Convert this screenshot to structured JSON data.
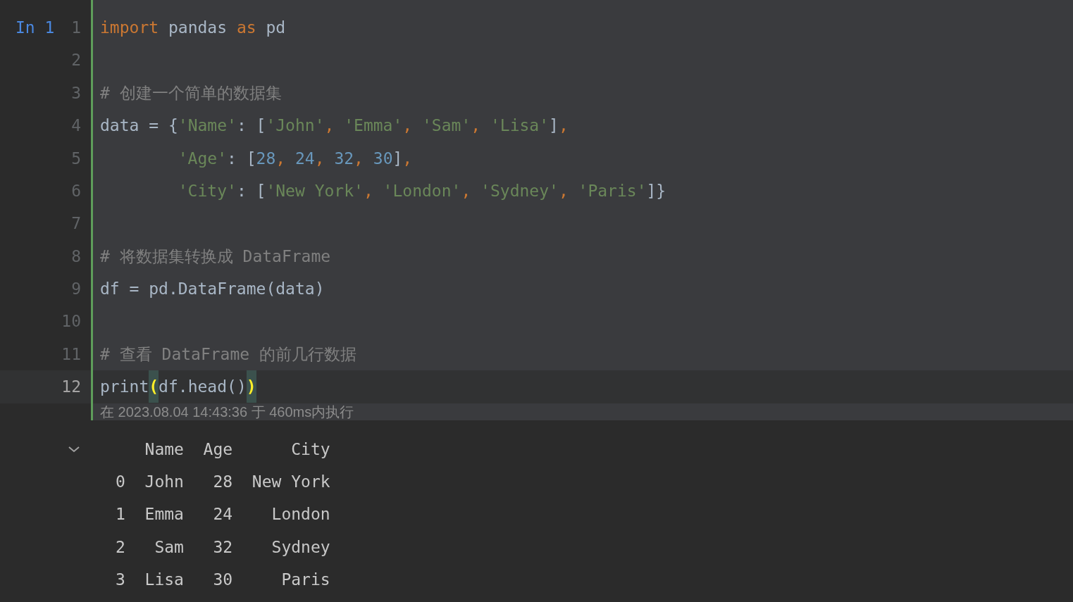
{
  "cell": {
    "prompt": "In 1",
    "lines": [
      {
        "number": "1",
        "current": false,
        "tokens": [
          {
            "kind": "keyword",
            "text": "import"
          },
          {
            "kind": "plain",
            "text": " pandas "
          },
          {
            "kind": "keyword",
            "text": "as"
          },
          {
            "kind": "plain",
            "text": " pd"
          }
        ]
      },
      {
        "number": "2",
        "current": false
      },
      {
        "number": "3",
        "current": false,
        "tokens": [
          {
            "kind": "comment",
            "text": "# 创建一个简单的数据集"
          }
        ]
      },
      {
        "number": "4",
        "current": false,
        "tokens": [
          {
            "kind": "plain",
            "text": "data = {"
          },
          {
            "kind": "string",
            "text": "'Name'"
          },
          {
            "kind": "plain",
            "text": ": ["
          },
          {
            "kind": "string",
            "text": "'John'"
          },
          {
            "kind": "punct",
            "text": ", "
          },
          {
            "kind": "string",
            "text": "'Emma'"
          },
          {
            "kind": "punct",
            "text": ", "
          },
          {
            "kind": "string",
            "text": "'Sam'"
          },
          {
            "kind": "punct",
            "text": ", "
          },
          {
            "kind": "string",
            "text": "'Lisa'"
          },
          {
            "kind": "plain",
            "text": "]"
          },
          {
            "kind": "punct",
            "text": ","
          }
        ]
      },
      {
        "number": "5",
        "current": false,
        "tokens": [
          {
            "kind": "string",
            "text": "        'Age'"
          },
          {
            "kind": "plain",
            "text": ": ["
          },
          {
            "kind": "number",
            "text": "28"
          },
          {
            "kind": "punct",
            "text": ", "
          },
          {
            "kind": "number",
            "text": "24"
          },
          {
            "kind": "punct",
            "text": ", "
          },
          {
            "kind": "number",
            "text": "32"
          },
          {
            "kind": "punct",
            "text": ", "
          },
          {
            "kind": "number",
            "text": "30"
          },
          {
            "kind": "plain",
            "text": "]"
          },
          {
            "kind": "punct",
            "text": ","
          }
        ]
      },
      {
        "number": "6",
        "current": false,
        "tokens": [
          {
            "kind": "string",
            "text": "        'City'"
          },
          {
            "kind": "plain",
            "text": ": ["
          },
          {
            "kind": "string",
            "text": "'New York'"
          },
          {
            "kind": "punct",
            "text": ", "
          },
          {
            "kind": "string",
            "text": "'London'"
          },
          {
            "kind": "punct",
            "text": ", "
          },
          {
            "kind": "string",
            "text": "'Sydney'"
          },
          {
            "kind": "punct",
            "text": ", "
          },
          {
            "kind": "string",
            "text": "'Paris'"
          },
          {
            "kind": "plain",
            "text": "]}"
          }
        ]
      },
      {
        "number": "7",
        "current": false
      },
      {
        "number": "8",
        "current": false,
        "tokens": [
          {
            "kind": "comment",
            "text": "# 将数据集转换成 DataFrame"
          }
        ]
      },
      {
        "number": "9",
        "current": false,
        "tokens": [
          {
            "kind": "plain",
            "text": "df = pd.DataFrame(data)"
          }
        ]
      },
      {
        "number": "10",
        "current": false
      },
      {
        "number": "11",
        "current": false,
        "tokens": [
          {
            "kind": "comment",
            "text": "# 查看 DataFrame 的前几行数据"
          }
        ]
      },
      {
        "number": "12",
        "current": true,
        "tokens": [
          {
            "kind": "plain",
            "text": "print"
          },
          {
            "kind": "matched",
            "text": "("
          },
          {
            "kind": "plain",
            "text": "df.head()"
          },
          {
            "kind": "matched",
            "text": ")"
          }
        ]
      }
    ],
    "execution_info": "在 2023.08.04 14:43:36 于 460ms内执行"
  },
  "output": {
    "expanded": true,
    "lines": [
      "   Name  Age      City",
      "0  John   28  New York",
      "1  Emma   24    London",
      "2   Sam   32    Sydney",
      "3  Lisa   30     Paris"
    ]
  }
}
